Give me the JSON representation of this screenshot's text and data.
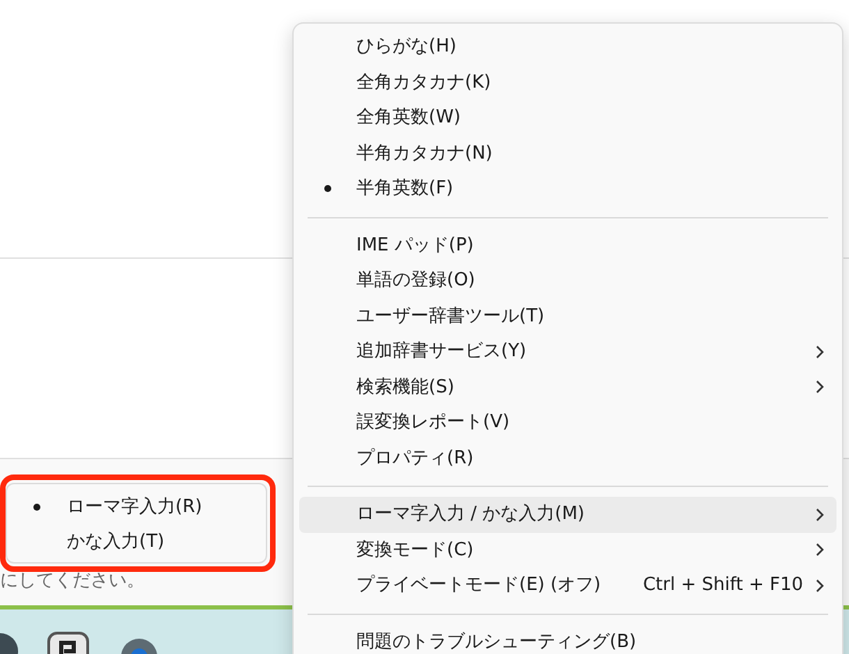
{
  "page": {
    "hint_text": "にしてください。"
  },
  "menu": {
    "items": [
      {
        "kind": "item",
        "label": "ひらがな(H)",
        "selected": false,
        "submenu": false,
        "highlighted": false
      },
      {
        "kind": "item",
        "label": "全角カタカナ(K)",
        "selected": false,
        "submenu": false,
        "highlighted": false
      },
      {
        "kind": "item",
        "label": "全角英数(W)",
        "selected": false,
        "submenu": false,
        "highlighted": false
      },
      {
        "kind": "item",
        "label": "半角カタカナ(N)",
        "selected": false,
        "submenu": false,
        "highlighted": false
      },
      {
        "kind": "item",
        "label": "半角英数(F)",
        "selected": true,
        "submenu": false,
        "highlighted": false
      },
      {
        "kind": "separator"
      },
      {
        "kind": "item",
        "label": "IME パッド(P)",
        "selected": false,
        "submenu": false,
        "highlighted": false
      },
      {
        "kind": "item",
        "label": "単語の登録(O)",
        "selected": false,
        "submenu": false,
        "highlighted": false
      },
      {
        "kind": "item",
        "label": "ユーザー辞書ツール(T)",
        "selected": false,
        "submenu": false,
        "highlighted": false
      },
      {
        "kind": "item",
        "label": "追加辞書サービス(Y)",
        "selected": false,
        "submenu": true,
        "highlighted": false
      },
      {
        "kind": "item",
        "label": "検索機能(S)",
        "selected": false,
        "submenu": true,
        "highlighted": false
      },
      {
        "kind": "item",
        "label": "誤変換レポート(V)",
        "selected": false,
        "submenu": false,
        "highlighted": false
      },
      {
        "kind": "item",
        "label": "プロパティ(R)",
        "selected": false,
        "submenu": false,
        "highlighted": false
      },
      {
        "kind": "separator"
      },
      {
        "kind": "item",
        "label": "ローマ字入力 / かな入力(M)",
        "selected": false,
        "submenu": true,
        "highlighted": true
      },
      {
        "kind": "item",
        "label": "変換モード(C)",
        "selected": false,
        "submenu": true,
        "highlighted": false
      },
      {
        "kind": "item",
        "label": "プライベートモード(E) (オフ)",
        "shortcut": "Ctrl + Shift + F10",
        "selected": false,
        "submenu": true,
        "highlighted": false
      },
      {
        "kind": "separator"
      },
      {
        "kind": "item",
        "label": "問題のトラブルシューティング(B)",
        "selected": false,
        "submenu": false,
        "highlighted": false
      }
    ]
  },
  "submenu": {
    "items": [
      {
        "label": "ローマ字入力(R)",
        "selected": true
      },
      {
        "label": "かな入力(T)",
        "selected": false
      }
    ]
  }
}
